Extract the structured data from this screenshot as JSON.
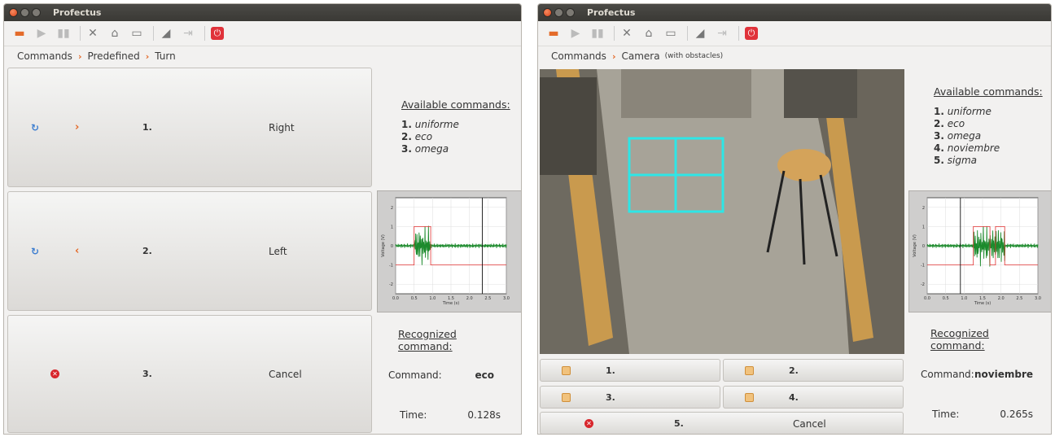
{
  "colors": {
    "accent": "#e46b2a",
    "title_bg": "#3f3e3a",
    "grid_cyan": "#2ee6e6",
    "signal_green": "#1c8a2c",
    "command_red": "#e03030"
  },
  "left": {
    "title": "Profectus",
    "breadcrumb": [
      "Commands",
      "Predefined",
      "Turn"
    ],
    "buttons": [
      {
        "num": "1.",
        "label": "Right",
        "icon": "refresh-icon",
        "arrow": "›"
      },
      {
        "num": "2.",
        "label": "Left",
        "icon": "refresh-icon",
        "arrow": "‹"
      },
      {
        "num": "3.",
        "label": "Cancel",
        "icon": "cancel-icon"
      }
    ],
    "available_title": "Available commands:",
    "commands": [
      {
        "n": "1.",
        "name": "uniforme"
      },
      {
        "n": "2.",
        "name": "eco"
      },
      {
        "n": "3.",
        "name": "omega"
      }
    ],
    "recognized_title": "Recognized command:",
    "command_label": "Command:",
    "command_value": "eco",
    "time_label": "Time:",
    "time_value": "0.128s"
  },
  "right": {
    "title": "Profectus",
    "breadcrumb": [
      "Commands",
      "Camera"
    ],
    "breadcrumb_note": "(with obstacles)",
    "grid_buttons": [
      {
        "num": "1."
      },
      {
        "num": "2."
      },
      {
        "num": "3."
      },
      {
        "num": "4."
      }
    ],
    "cancel_num": "5.",
    "cancel_label": "Cancel",
    "available_title": "Available commands:",
    "commands": [
      {
        "n": "1.",
        "name": "uniforme"
      },
      {
        "n": "2.",
        "name": "eco"
      },
      {
        "n": "3.",
        "name": "omega"
      },
      {
        "n": "4.",
        "name": "noviembre"
      },
      {
        "n": "5.",
        "name": "sigma"
      }
    ],
    "recognized_title": "Recognized command:",
    "command_label": "Command:",
    "command_value": "noviembre",
    "time_label": "Time:",
    "time_value": "0.265s"
  },
  "plot": {
    "ylabel": "Voltage (V)",
    "xlabel": "Time (s)",
    "yticks": [
      "2",
      "1",
      "0",
      "-1",
      "-2"
    ],
    "xticks": [
      "0.0",
      "0.5",
      "1.0",
      "1.5",
      "2.0",
      "2.5",
      "3.0"
    ]
  },
  "chart_data": [
    {
      "type": "line",
      "xlabel": "Time (s)",
      "ylabel": "Voltage (V)",
      "xlim": [
        0,
        3.0
      ],
      "ylim": [
        -2.5,
        2.5
      ],
      "series": [
        {
          "values": [
            [
              0,
              -1
            ],
            [
              0.5,
              -1
            ],
            [
              0.5,
              1
            ],
            [
              0.95,
              1
            ],
            [
              0.95,
              -1
            ],
            [
              3.0,
              -1
            ]
          ]
        }
      ],
      "marker_x": 2.35,
      "burst": [
        0.5,
        0.95
      ]
    },
    {
      "type": "line",
      "xlabel": "Time (s)",
      "ylabel": "Voltage (V)",
      "xlim": [
        0,
        3.0
      ],
      "ylim": [
        -2.5,
        2.5
      ],
      "series": [
        {
          "values": [
            [
              0,
              -1
            ],
            [
              1.25,
              -1
            ],
            [
              1.25,
              1
            ],
            [
              1.7,
              1
            ],
            [
              1.7,
              -1
            ],
            [
              1.85,
              -1
            ],
            [
              1.85,
              1
            ],
            [
              2.1,
              1
            ],
            [
              2.1,
              -1
            ],
            [
              3.0,
              -1
            ]
          ]
        }
      ],
      "marker_x": 0.9,
      "burst": [
        1.25,
        2.1
      ]
    }
  ]
}
